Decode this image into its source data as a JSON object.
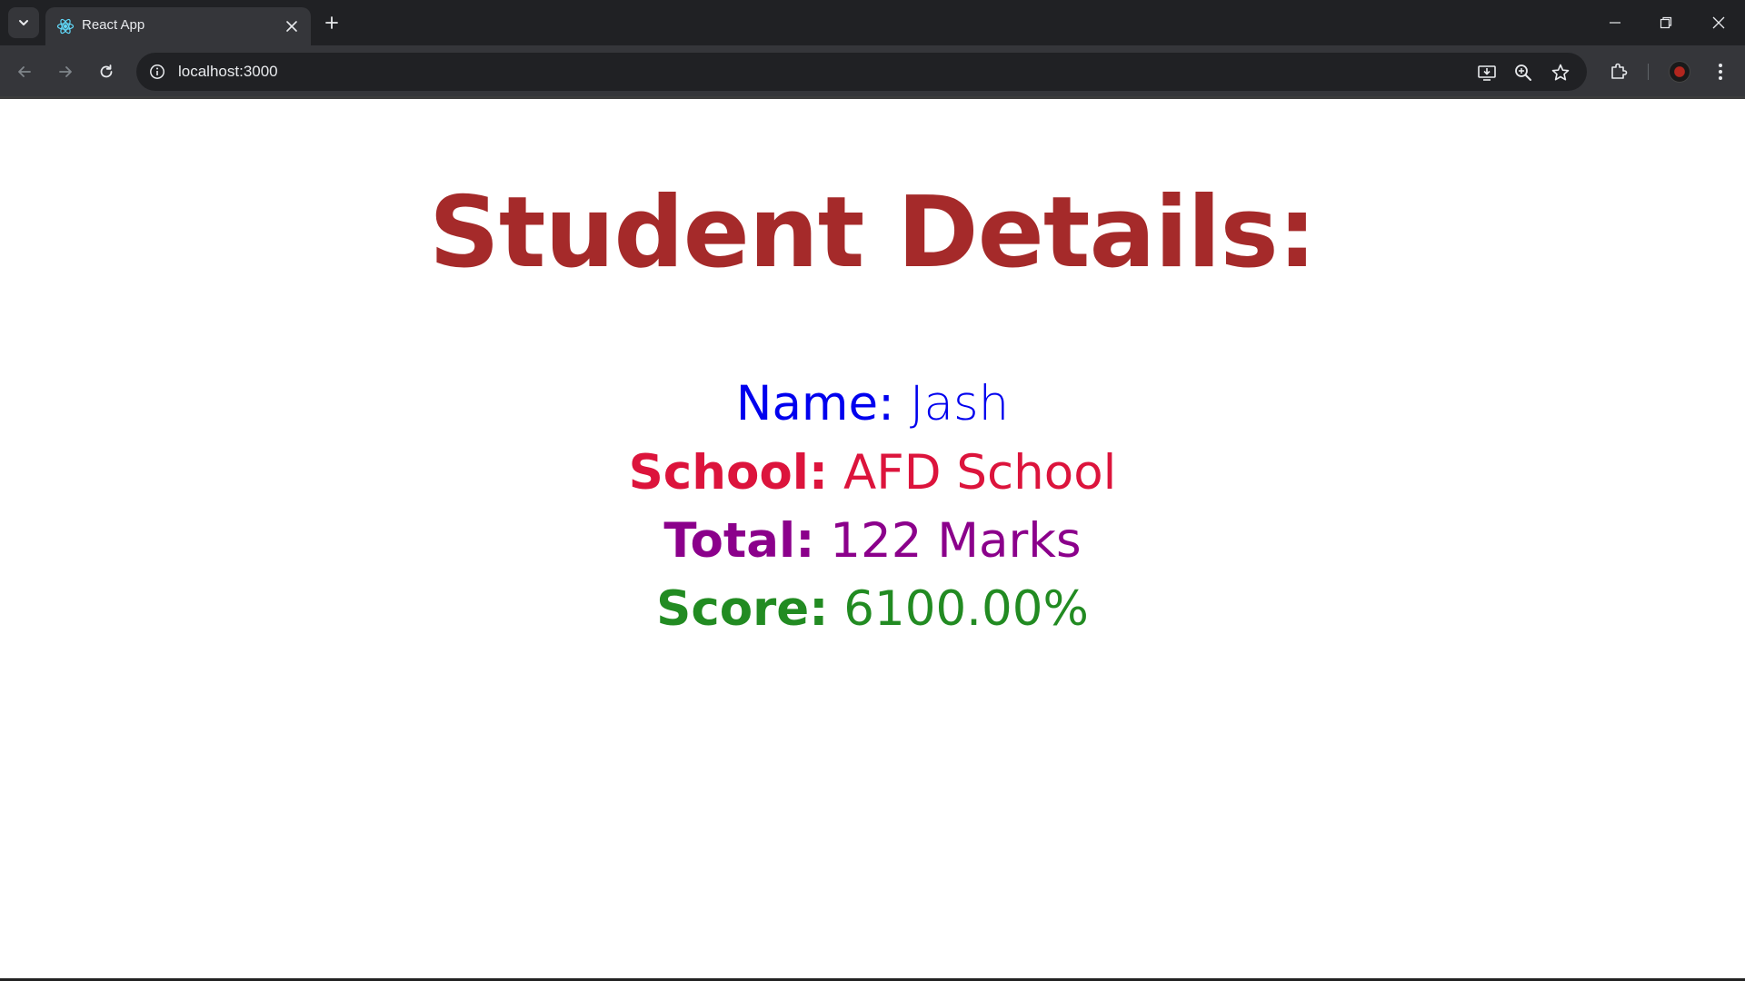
{
  "browser": {
    "tab_title": "React App",
    "url": "localhost:3000",
    "icons": {
      "tab_search": "chevron-down-icon",
      "favicon": "react-logo-icon",
      "tab_close": "close-icon",
      "new_tab": "plus-icon",
      "back": "arrow-left-icon",
      "forward": "arrow-right-icon",
      "reload": "reload-icon",
      "site_info": "info-icon",
      "install": "install-app-icon",
      "zoom": "zoom-icon",
      "bookmark": "star-icon",
      "extensions": "puzzle-icon",
      "menu": "kebab-menu-icon"
    }
  },
  "page": {
    "title": "Student Details:",
    "details": {
      "name": {
        "label": "Name:",
        "value": "Jash",
        "color": "#0000ee"
      },
      "school": {
        "label": "School:",
        "value": "AFD School",
        "color": "#dc143c"
      },
      "total": {
        "label": "Total:",
        "value": "122 Marks",
        "color": "#8b008b"
      },
      "score": {
        "label": "Score:",
        "value": "6100.00%",
        "color": "#228b22"
      }
    },
    "title_color": "#a52a2a"
  }
}
